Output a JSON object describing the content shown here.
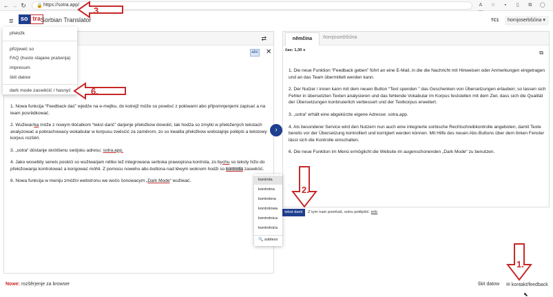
{
  "browser": {
    "url": "https://sotra.app/",
    "back_icon": "←",
    "forward_icon": "→",
    "reload_icon": "↻",
    "home_icon": "⌂"
  },
  "app": {
    "logo_left": "so",
    "logo_right": "tra",
    "name": "Sorbian Translator",
    "badge": "TC1",
    "language_selector": "hornjoserbšćina ▾"
  },
  "menu": {
    "items": [
      "přełožk",
      "přizjewić so",
      "FAQ (husto stajane prašenja)",
      "impresum",
      "škit datow",
      "dark mode zaswěćić / hasnyć"
    ]
  },
  "source": {
    "paragraphs": [
      [
        "1. Nowa funkcija “Feedback dać” wjedźe na e-mejlku, do kotrejž móže so powěsć z pokiwami abo připomnjenjemi zapisać a na team posrědkować."
      ],
      [
        "2. Wužiwar/",
        "ka",
        " móže z nowym tłóčatkom “tekst darić” darjenje přełožkow dowolić; tak hodźa so zmylki w přełožených tekstach analyzować a pobrachowacy wokabular w korpusu zwěsćić za zaměrom, zo so kwalita přełožkow wobstajnje polěpši a tekstowy korpus rozšěri."
      ],
      [
        "3. „sotra“ dóstanje skrótšenu swójsku adresu: ",
        "sotra.app."
      ],
      [
        "4. Jako wosebity serwis poskići so wužiwarjam nětko tež integrowana serbska prawopisna kontrola, zo by",
        "chu",
        " so teksty hižo do přełožowanja kontrolować a korigować móhli. Z pomocu noweho abc-buttona nad lěwym woknom hodźi so ",
        "kontrolla",
        " zaswěćić."
      ],
      [
        "6. Nowa funkcija w meniju zmóžni webstronu we wočo šonowacym „",
        "Dark Mode",
        "“ wužiwać."
      ]
    ]
  },
  "suggestions": [
    "kontrola",
    "kontrolna",
    "kontrolera",
    "kontrolowa",
    "kontrolnica",
    "kontrolnića",
    "soblexx"
  ],
  "target": {
    "tabs": [
      "němčina",
      "hornjoserbšćina"
    ],
    "time": "čas: 1,30 s",
    "paragraphs": [
      "1. Die neue Funktion “Feedback geben” führt an eine E-Mail, in die die Nachricht mit Hinweisen oder Anmerkungen eingetragen und an das Team übermittelt werden kann.",
      "2. Der Nutzer / innen kann mit dem neuen Button “Text spenden ” das Geschenken von Übersetzungen erlauben; so lassen sich Fehler in übersetzten Texten analysieren und das fehlende Vokabular im Korpus feststellen mit dem Ziel, dass sich die Qualität der Übersetzungen kontinuierlich verbessert und der Textkorpus erweitert.",
      "3. „sotra“ erhält eine abgekürzte eigene Adresse: sotra.app.",
      "4. Als besonderer Service wird den Nutzern nun auch eine integrierte sorbische Rechtschreibkontrolle angeboten, damit Texte bereits vor der Übersetzung kontrolliert und korrigiert werden können. Mit Hilfe des neuen Abc-Buttons über dem linken Fenster lässt sich die Kontrolle einschalten.",
      "6. Die neue Funktion im Menü ermöglicht die Website im augenschonenden „Dark Mode“ zu benutzen."
    ]
  },
  "feedback": {
    "button": "tekst darić",
    "note_prefix": "Z tym nam pomhaš, sotru polěpšić. ",
    "note_link": "info"
  },
  "footer": {
    "new_label": "Nowe:",
    "new_text": " rozšěrjenje za browser",
    "privacy": "škit datow",
    "contact": "✉ kontakt/feedback"
  },
  "callouts": [
    "1.",
    "2.",
    "3.",
    "6."
  ],
  "colors": {
    "brand": "#1f3f8f",
    "accent_red": "#c62828"
  }
}
